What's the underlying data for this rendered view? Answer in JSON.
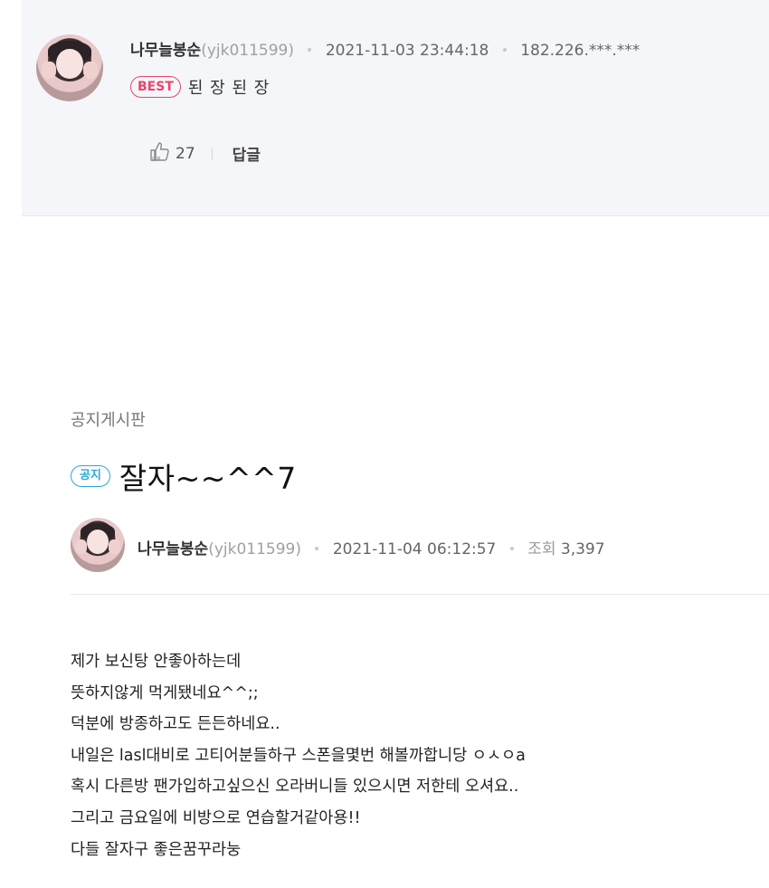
{
  "comment": {
    "author_name": "나무늘봉순",
    "author_id": "(yjk011599)",
    "date": "2021-11-03 23:44:18",
    "ip": "182.226.***.***",
    "badge": "BEST",
    "text": "된 장 된 장",
    "likes": "27",
    "reply_label": "답글",
    "like_icon": "thumbs-up-icon"
  },
  "article": {
    "board_name": "공지게시판",
    "badge": "공지",
    "title": "잘자~~^^7",
    "author_name": "나무늘봉순",
    "author_id": "(yjk011599)",
    "date": "2021-11-04 06:12:57",
    "views_label": "조회",
    "views": "3,397",
    "body": [
      "제가 보신탕 안좋아하는데",
      "뜻하지않게 먹게됐네요^^;;",
      "덕분에 방종하고도 든든하네요..",
      "내일은 lasl대비로 고티어분들하구 스폰을몇번 해볼까합니당 ㅇㅅㅇa",
      "혹시 다른방 팬가입하고싶으신 오라버니들 있으시면 저한테 오셔요..",
      "그리고 금요일에 비방으로 연습할거같아용!!",
      "다들 잘자구 좋은꿈꾸라눙"
    ]
  },
  "colors": {
    "best": "#e6476c",
    "notice": "#2aa7d8",
    "comment_bg": "#f5f6fa"
  }
}
